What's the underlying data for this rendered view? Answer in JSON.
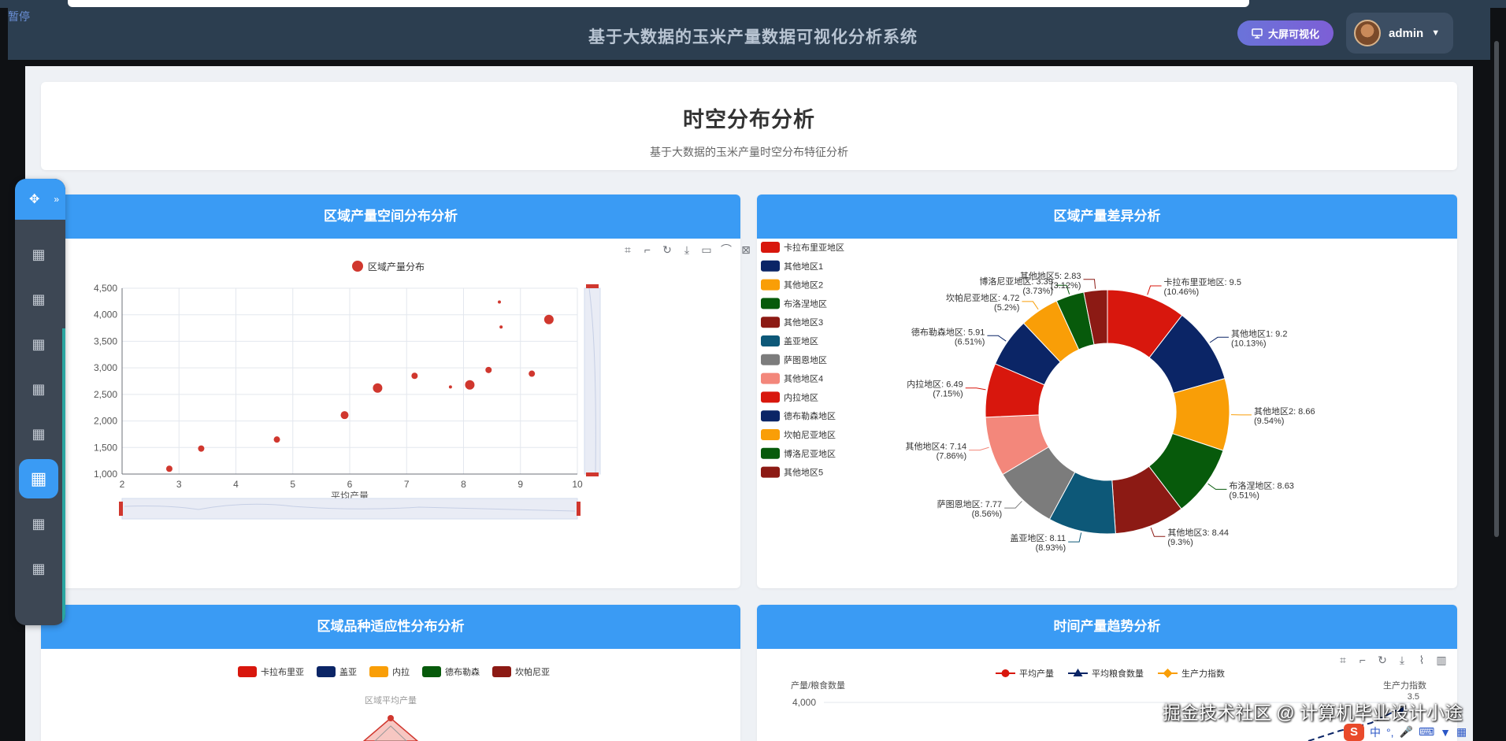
{
  "app": {
    "paused_label": "暂停",
    "title": "基于大数据的玉米产量数据可视化分析系统",
    "bigscreen_label": "大屏可视化",
    "user_name": "admin"
  },
  "banner": {
    "title": "时空分布分析",
    "subtitle": "基于大数据的玉米产量时空分布特征分析"
  },
  "panels": {
    "scatter_title": "区域产量空间分布分析",
    "pie_title": "区域产量差异分析",
    "radar_title": "区域品种适应性分布分析",
    "trend_title": "时间产量趋势分析"
  },
  "watermark": "掘金技术社区 @ 计算机毕业设计小途",
  "ime_label": "中",
  "chart_data": [
    {
      "type": "scatter",
      "legend": [
        "区域产量分布"
      ],
      "xlabel": "平均产量",
      "ylabel": "",
      "xlim": [
        2,
        10
      ],
      "ylim": [
        1000,
        4500
      ],
      "x_ticks": [
        2,
        3,
        4,
        5,
        6,
        7,
        8,
        9,
        10
      ],
      "y_ticks": [
        "1,000",
        "1,500",
        "2,000",
        "2,500",
        "3,000",
        "3,500",
        "4,000",
        "4,500"
      ],
      "grid": true,
      "color": "#d0372e",
      "points": [
        {
          "x": 2.83,
          "y": 1100,
          "s": 4
        },
        {
          "x": 3.39,
          "y": 1480,
          "s": 4
        },
        {
          "x": 4.72,
          "y": 1650,
          "s": 4
        },
        {
          "x": 5.91,
          "y": 2110,
          "s": 5
        },
        {
          "x": 6.49,
          "y": 2620,
          "s": 6
        },
        {
          "x": 7.14,
          "y": 2850,
          "s": 4
        },
        {
          "x": 7.77,
          "y": 2640,
          "s": 2
        },
        {
          "x": 8.11,
          "y": 2680,
          "s": 6
        },
        {
          "x": 8.44,
          "y": 2960,
          "s": 4
        },
        {
          "x": 8.63,
          "y": 4240,
          "s": 2
        },
        {
          "x": 8.66,
          "y": 3770,
          "s": 2
        },
        {
          "x": 9.2,
          "y": 2890,
          "s": 4
        },
        {
          "x": 9.5,
          "y": 3910,
          "s": 6
        }
      ]
    },
    {
      "type": "pie",
      "slices": [
        {
          "name": "卡拉布里亚地区",
          "value": 9.5,
          "pct": "10.46%",
          "color": "#d8170d"
        },
        {
          "name": "其他地区1",
          "value": 9.2,
          "pct": "10.13%",
          "color": "#0b2566"
        },
        {
          "name": "其他地区2",
          "value": 8.66,
          "pct": "9.54%",
          "color": "#f99e07"
        },
        {
          "name": "布洛涅地区",
          "value": 8.63,
          "pct": "9.51%",
          "color": "#075a0b"
        },
        {
          "name": "其他地区3",
          "value": 8.44,
          "pct": "9.3%",
          "color": "#8c1a14"
        },
        {
          "name": "盖亚地区",
          "value": 8.11,
          "pct": "8.93%",
          "color": "#0d5878"
        },
        {
          "name": "萨图恩地区",
          "value": 7.77,
          "pct": "8.56%",
          "color": "#7c7c7c"
        },
        {
          "name": "其他地区4",
          "value": 7.14,
          "pct": "7.86%",
          "color": "#f3877b"
        },
        {
          "name": "内拉地区",
          "value": 6.49,
          "pct": "7.15%",
          "color": "#d8170d"
        },
        {
          "name": "德布勒森地区",
          "value": 5.91,
          "pct": "6.51%",
          "color": "#0b2566"
        },
        {
          "name": "坎帕尼亚地区",
          "value": 4.72,
          "pct": "5.2%",
          "color": "#f99e07"
        },
        {
          "name": "博洛尼亚地区",
          "value": 3.39,
          "pct": "3.73%",
          "color": "#075a0b"
        },
        {
          "name": "其他地区5",
          "value": 2.83,
          "pct": "3.12%",
          "color": "#8c1a14"
        }
      ]
    },
    {
      "type": "radar",
      "legend": [
        {
          "name": "卡拉布里亚",
          "color": "#d8170d"
        },
        {
          "name": "盖亚",
          "color": "#0b2566"
        },
        {
          "name": "内拉",
          "color": "#f99e07"
        },
        {
          "name": "德布勒森",
          "color": "#075a0b"
        },
        {
          "name": "坎帕尼亚",
          "color": "#8c1a14"
        }
      ],
      "indicator": "区域平均产量"
    },
    {
      "type": "line",
      "legend": [
        {
          "name": "平均产量",
          "color": "#d8170d",
          "marker": "circle"
        },
        {
          "name": "平均粮食数量",
          "color": "#0b2566",
          "marker": "triangle"
        },
        {
          "name": "生产力指数",
          "color": "#f99e07",
          "marker": "diamond"
        }
      ],
      "ylabel_left": "产量/粮食数量",
      "ylabel_right": "生产力指数",
      "y_top_tick": "4,000",
      "y_right_top_tick": "3.5"
    }
  ]
}
